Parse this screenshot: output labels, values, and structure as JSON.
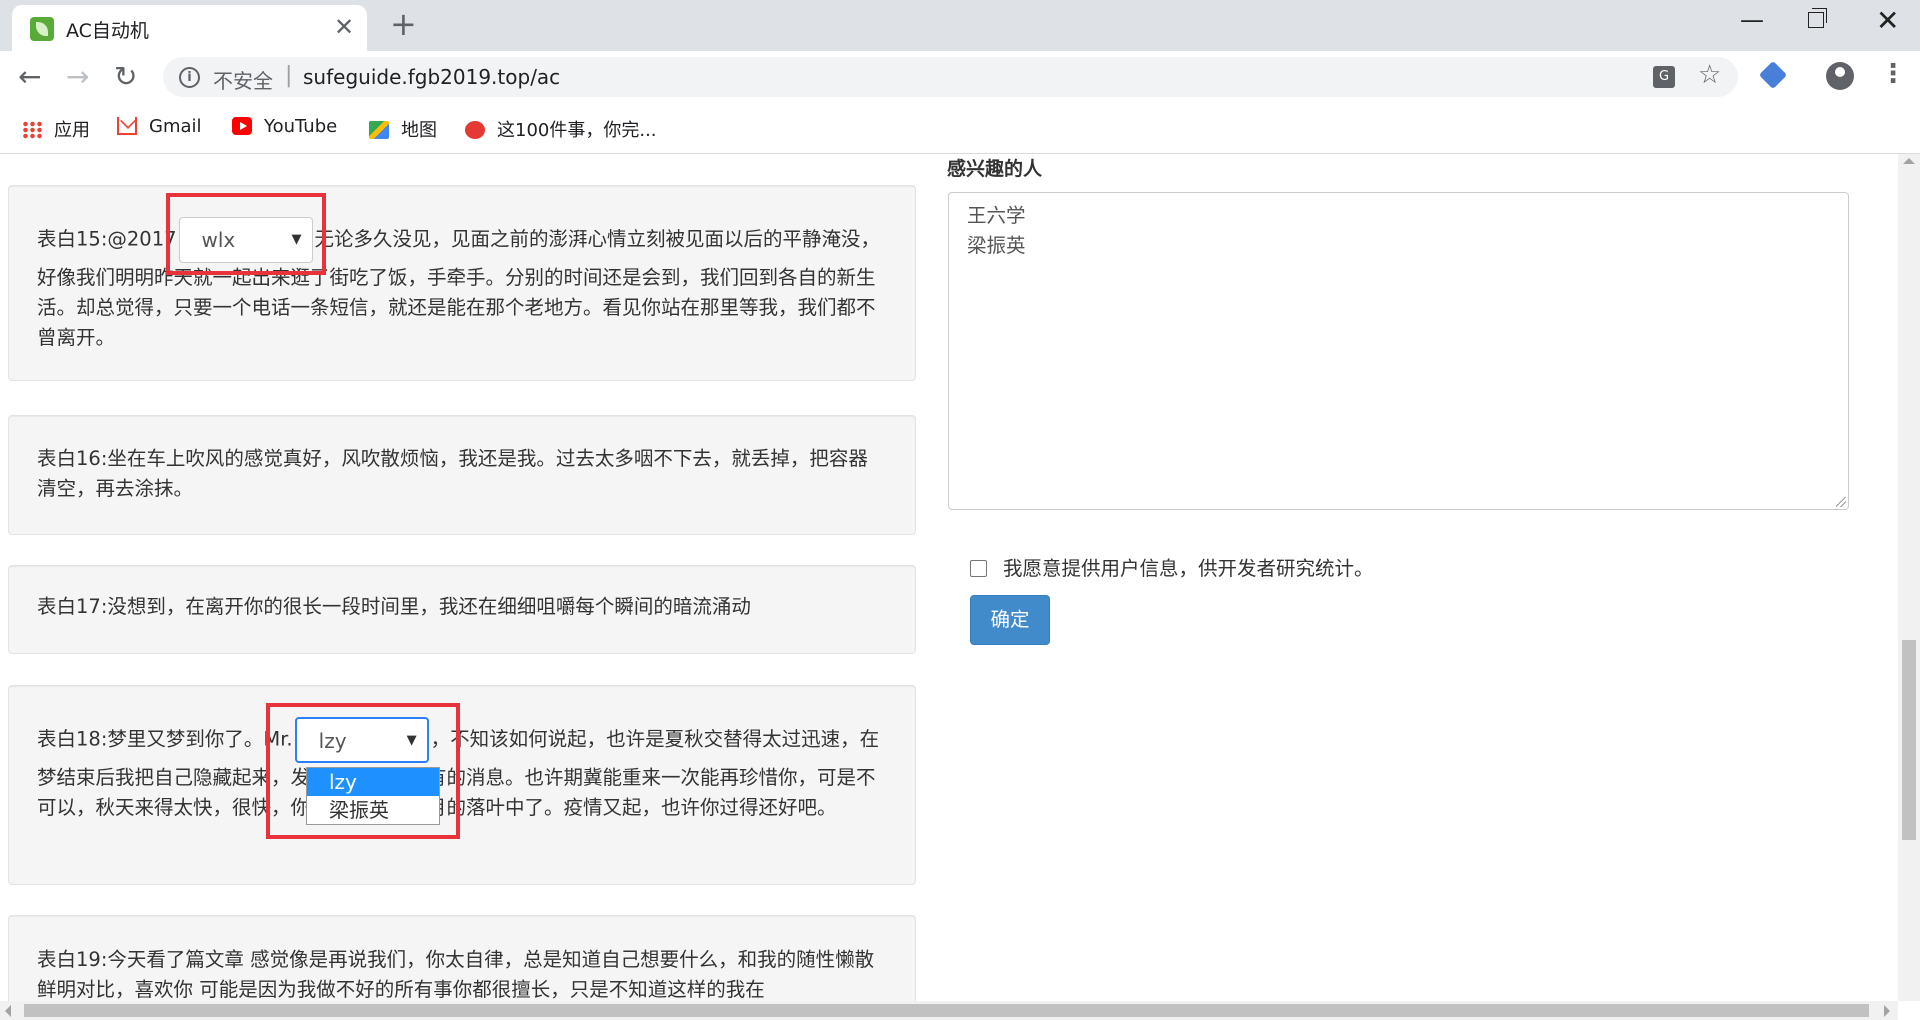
{
  "browser": {
    "tab_title": "AC自动机",
    "close_tab": "✕",
    "new_tab": "+",
    "back": "←",
    "forward": "→",
    "reload": "↻",
    "security_label": "不安全",
    "url": "sufeguide.fgb2019.top/ac",
    "window_minimize": "—",
    "window_close": "✕",
    "bookmarks": [
      "应用",
      "Gmail",
      "YouTube",
      "地图",
      "这100件事，你完..."
    ]
  },
  "confessions": {
    "c15": {
      "prefix": "表白15:@2017",
      "select_value": "wlx",
      "suffix": "无论多久没见，见面之前的澎湃心情立刻被见面以后的平静淹没，好像我们明明昨天就一起出来逛了街吃了饭，手牵手。分别的时间还是会到，我们回到各自的新生活。却总觉得，只要一个电话一条短信，就还是能在那个老地方。看见你站在那里等我，我们都不曾离开。"
    },
    "c16": {
      "text": "表白16:坐在车上吹风的感觉真好，风吹散烦恼，我还是我。过去太多咽不下去，就丢掉，把容器清空，再去涂抹。"
    },
    "c17": {
      "text": "表白17:没想到，在离开你的很长一段时间里，我还在细细咀嚼每个瞬间的暗流涌动"
    },
    "c18": {
      "prefix": "表白18:梦里又梦到你了。Mr.",
      "select_value": "lzy",
      "suffix": "，不知该如何说起，也许是夏秋交替得太过迅速，在梦结束后我把自己隐藏起来，发现丢掉了你所有的消息。也许期冀能重来一次能再珍惜你，可是不可以，秋天来得太快，很快，你也就消失在十月的落叶中了。疫情又起，也许你过得还好吧。",
      "options": [
        "lzy",
        "梁振英"
      ]
    },
    "c19": {
      "text": "表白19:今天看了篇文章 感觉像是再说我们，你太自律，总是知道自己想要什么，和我的随性懒散鲜明对比，喜欢你 可能是因为我做不好的所有事你都很擅长，只是不知道这样的我在"
    }
  },
  "sidebar": {
    "title": "感兴趣的人",
    "interested": [
      "王六学",
      "梁振英"
    ],
    "consent_label": "我愿意提供用户信息，供开发者研究统计。",
    "consent_checked": false,
    "submit_label": "确定"
  },
  "colors": {
    "primary": "#428bca",
    "highlight": "#e8323c",
    "selected_option": "#1e90ff"
  }
}
